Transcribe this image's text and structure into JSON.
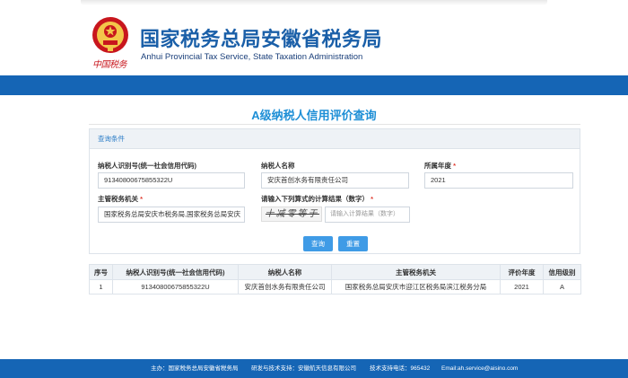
{
  "header": {
    "emblem_icon": "tax-service-emblem-icon",
    "calligraphy": "中国税务",
    "title": "国家税务总局安徽省税务局",
    "subtitle": "Anhui Provincial Tax Service, State Taxation Administration",
    "brand_color": "#1565b5",
    "title_color": "#1a5fa8"
  },
  "page": {
    "title": "A级纳税人信用评价查询",
    "title_color": "#1e8fd6"
  },
  "query": {
    "panel_title": "查询条件",
    "taxpayer_id_label": "纳税人识别号(统一社会信用代码)",
    "taxpayer_id_value": "91340800675855322U",
    "taxpayer_name_label": "纳税人名称",
    "taxpayer_name_value": "安庆首创水务有限责任公司",
    "year_label": "所属年度",
    "year_value": "2021",
    "authority_label": "主管税务机关",
    "authority_value": "国家税务总局安庆市税务局,国家税务总局安庆",
    "captcha_label": "请输入下列算式的计算结果（数字）",
    "captcha_text": "十减零等于",
    "captcha_placeholder": "请输入计算结果（数字）",
    "required_mark": "*",
    "query_button": "查询",
    "reset_button": "重置"
  },
  "results": {
    "headers": [
      "序号",
      "纳税人识别号(统一社会信用代码)",
      "纳税人名称",
      "主管税务机关",
      "评价年度",
      "信用级别"
    ],
    "rows": [
      [
        "1",
        "91340800675855322U",
        "安庆首创水务有限责任公司",
        "国家税务总局安庆市迎江区税务局滨江税务分局",
        "2021",
        "A"
      ]
    ]
  },
  "footer": {
    "sponsor": "主办：国家税务总局安徽省税务局",
    "tech_support": "研发与技术支持：安徽航天信息有限公司",
    "hotline": "技术支持电话：965432",
    "email": "Email:ah.service@aisino.com"
  }
}
